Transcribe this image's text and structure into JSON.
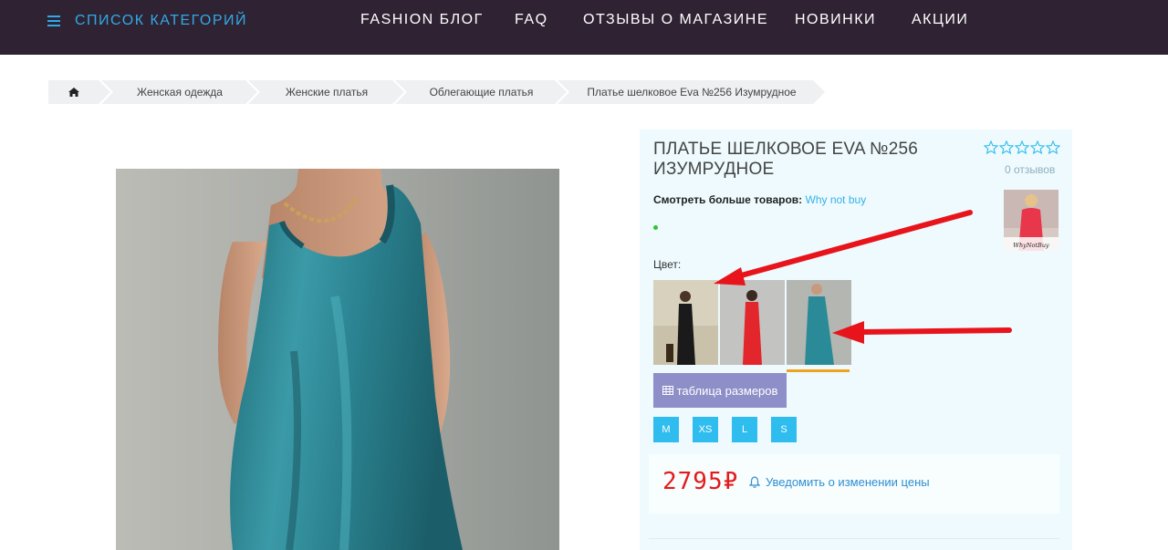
{
  "header": {
    "categories_label": "СПИСОК КАТЕГОРИЙ",
    "nav": [
      "FASHION БЛОГ",
      "FAQ",
      "ОТЗЫВЫ О МАГАЗИНЕ",
      "НОВИНКИ",
      "АКЦИИ"
    ]
  },
  "breadcrumb": [
    "Женская одежда",
    "Женские платья",
    "Облегающие платья",
    "Платье шелковое Eva №256 Изумрудное"
  ],
  "product": {
    "title": "ПЛАТЬЕ ШЕЛКОВОЕ EVA №256 ИЗУМРУДНОЕ",
    "rating_stars": 0,
    "reviews": "0 отзывов",
    "more_label": "Смотреть больше товаров:",
    "seller": "Why not buy",
    "seller_logo_text": "WhyNotBuy",
    "color_label": "Цвет:",
    "size_table": "таблица размеров",
    "sizes": [
      "M",
      "XS",
      "L",
      "S"
    ],
    "price": "2795₽",
    "notify": "Уведомить о изменении цены"
  },
  "colors": {
    "topbar": "#2f2333",
    "accent": "#30a9e6",
    "price": "#e31b1b",
    "size_button": "#2fbcef",
    "size_table_button": "#8e8ec8",
    "annotation_arrow": "#e8141c"
  }
}
